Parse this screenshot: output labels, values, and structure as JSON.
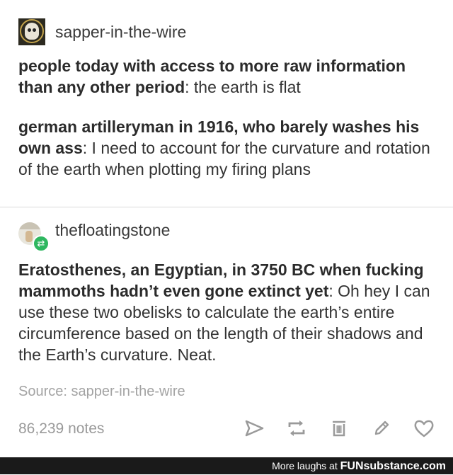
{
  "post": {
    "op_username": "sapper-in-the-wire",
    "p1_bold": "people today with access to more raw information than any other period",
    "p1_rest": ": the earth is flat",
    "p2_bold": "german artilleryman in 1916, who barely washes his own ass",
    "p2_rest": ": I need to account for the curvature and rotation of the earth when plotting my firing plans",
    "reblogger_username": "thefloatingstone",
    "p3_bold": "Eratosthenes, an Egyptian, in 3750 BC when fucking mammoths hadn’t even gone extinct yet",
    "p3_rest": ": Oh hey I can use these two obelisks to calculate the earth’s entire circumference based on the length of their shadows and the Earth’s curvature. Neat.",
    "source": "Source: sapper-in-the-wire",
    "notes": "86,239 notes"
  },
  "actions": [
    "share-icon",
    "reblog-icon",
    "delete-icon",
    "edit-icon",
    "like-icon"
  ],
  "watermark": {
    "prefix": "More laughs at ",
    "site": "FUNsubstance.com"
  },
  "colors": {
    "accent_green": "#2fb760",
    "icon_gray": "#9a9a9a"
  }
}
